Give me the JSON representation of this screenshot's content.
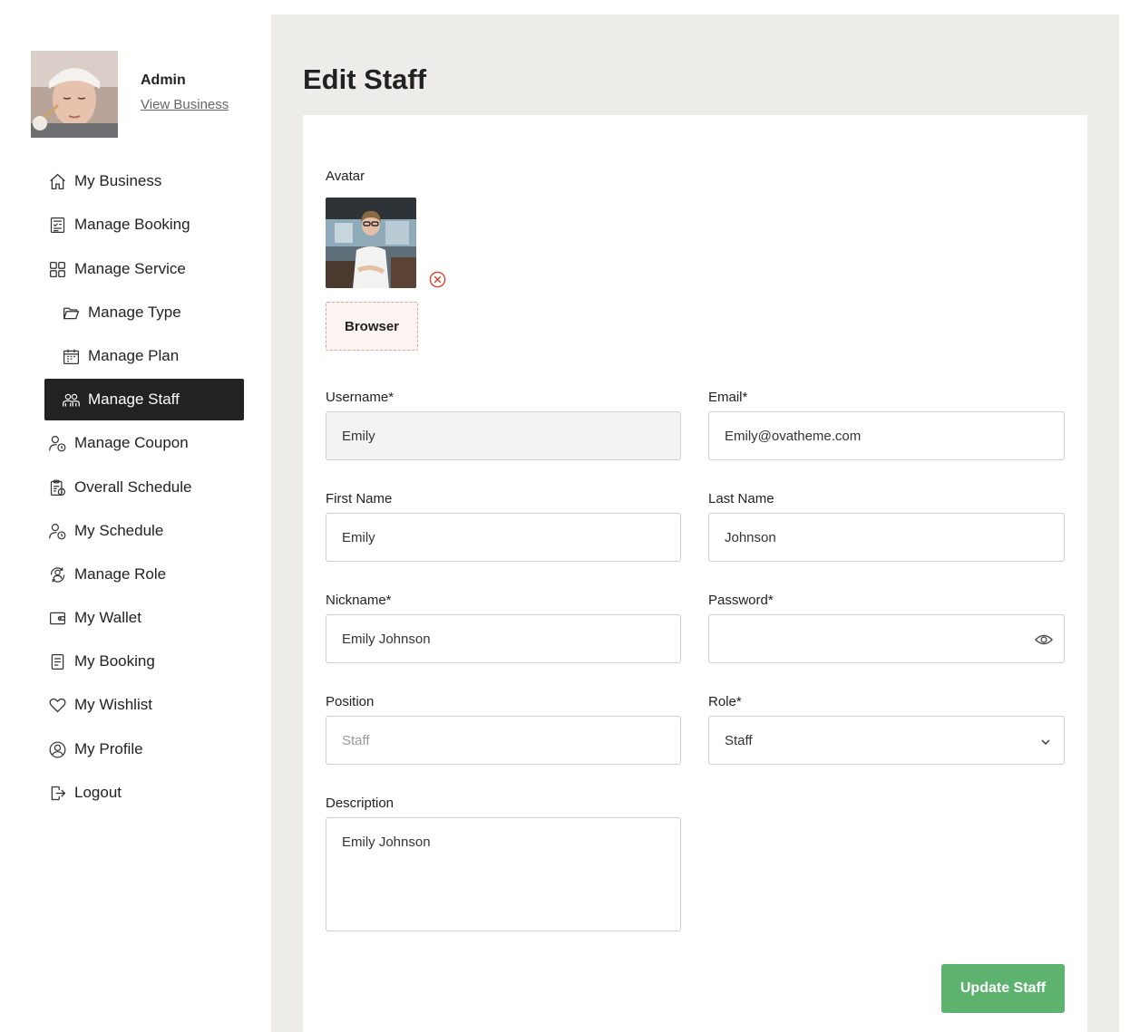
{
  "sidebar": {
    "profile": {
      "name": "Admin",
      "link": "View Business"
    },
    "items": [
      {
        "label": "My Business",
        "icon": "home-icon"
      },
      {
        "label": "Manage Booking",
        "icon": "booking-icon"
      },
      {
        "label": "Manage Service",
        "icon": "grid-icon"
      },
      {
        "label": "Manage Type",
        "icon": "folder-icon"
      },
      {
        "label": "Manage Plan",
        "icon": "calendar-icon"
      },
      {
        "label": "Manage Staff",
        "icon": "users-icon",
        "active": true
      },
      {
        "label": "Manage Coupon",
        "icon": "user-clock-icon"
      },
      {
        "label": "Overall Schedule",
        "icon": "clipboard-clock-icon"
      },
      {
        "label": "My Schedule",
        "icon": "user-clock-icon"
      },
      {
        "label": "Manage Role",
        "icon": "user-cycle-icon"
      },
      {
        "label": "My Wallet",
        "icon": "wallet-icon"
      },
      {
        "label": "My Booking",
        "icon": "document-icon"
      },
      {
        "label": "My Wishlist",
        "icon": "heart-icon"
      },
      {
        "label": "My Profile",
        "icon": "profile-icon"
      },
      {
        "label": "Logout",
        "icon": "logout-icon"
      }
    ]
  },
  "main": {
    "title": "Edit Staff",
    "form": {
      "avatar_label": "Avatar",
      "browser_label": "Browser",
      "username": {
        "label": "Username*",
        "value": "Emily"
      },
      "email": {
        "label": "Email*",
        "value": "Emily@ovatheme.com"
      },
      "first_name": {
        "label": "First Name",
        "value": "Emily"
      },
      "last_name": {
        "label": "Last Name",
        "value": "Johnson"
      },
      "nickname": {
        "label": "Nickname*",
        "value": "Emily Johnson"
      },
      "password": {
        "label": "Password*",
        "value": ""
      },
      "position": {
        "label": "Position",
        "placeholder": "Staff"
      },
      "role": {
        "label": "Role*",
        "value": "Staff"
      },
      "description": {
        "label": "Description",
        "value": "Emily Johnson"
      },
      "submit_label": "Update Staff"
    }
  },
  "colors": {
    "active_bg": "#222222",
    "main_bg": "#eeece9",
    "submit": "#5db36e",
    "remove": "#d9432f"
  }
}
